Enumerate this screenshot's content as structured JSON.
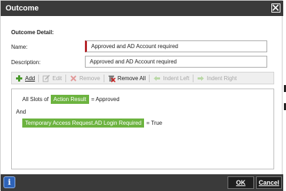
{
  "dialog": {
    "title": "Outcome"
  },
  "detail": {
    "section_title": "Outcome Detail:",
    "name_label": "Name:",
    "name_value": "Approved and AD Account required",
    "description_label": "Description:",
    "description_value": "Approved and AD Account required"
  },
  "toolbar": {
    "add": "Add",
    "edit": "Edit",
    "remove": "Remove",
    "remove_all": "Remove All",
    "indent_left": "Indent Left",
    "indent_right": "Indent Right"
  },
  "criteria": {
    "line1_prefix": "All Slots of",
    "line1_tag": "Action Result",
    "line1_suffix": "= Approved",
    "line2": "And",
    "line3_tag": "Temporary Access Request.AD Login Required",
    "line3_suffix": "= True"
  },
  "footer": {
    "ok": "OK",
    "cancel": "Cancel"
  },
  "colors": {
    "titlebar": "#3a3a3a",
    "tag_green": "#6cb33f",
    "required_red": "#b5252a",
    "info_blue": "#2e63b8"
  }
}
